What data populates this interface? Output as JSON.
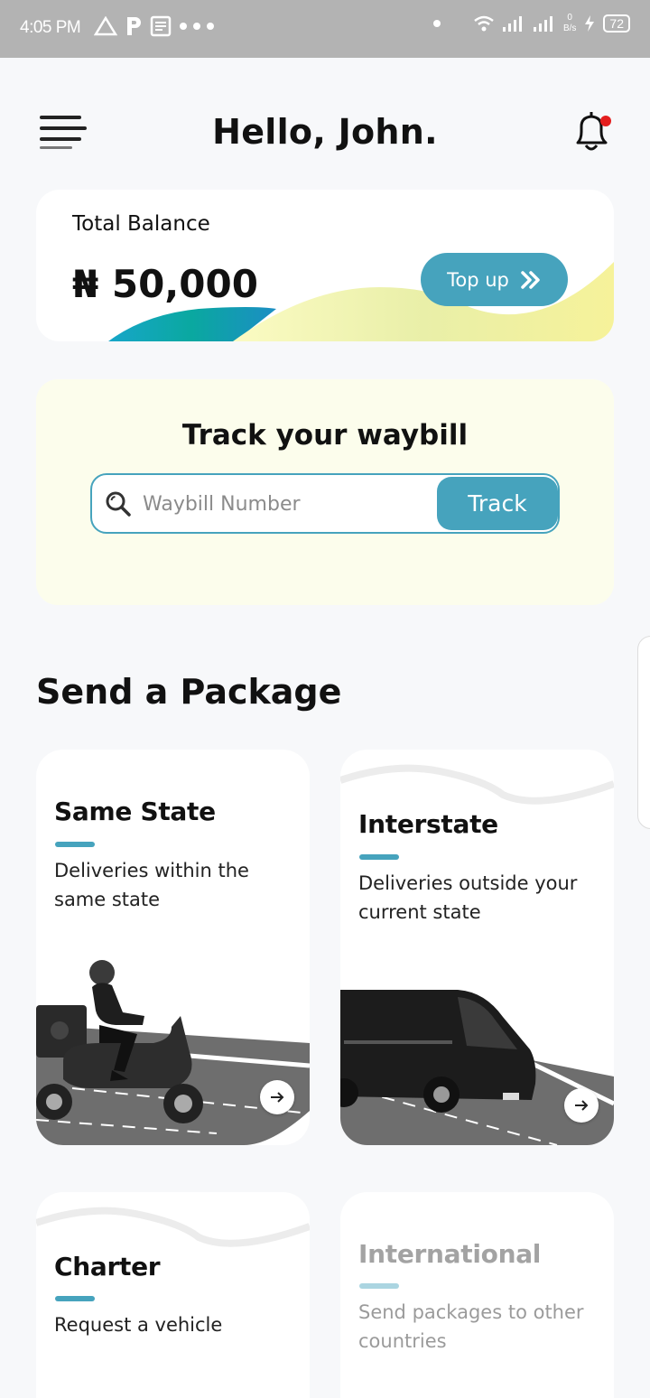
{
  "status_bar": {
    "time": "4:05 PM",
    "net_speed_value": "0",
    "net_speed_unit": "B/s",
    "battery": "72"
  },
  "header": {
    "greeting": "Hello, John."
  },
  "balance": {
    "label": "Total Balance",
    "amount": "₦ 50,000",
    "topup_label": "Top up"
  },
  "track": {
    "title": "Track your waybill",
    "placeholder": "Waybill Number",
    "button_label": "Track"
  },
  "send_package": {
    "title": "Send a Package",
    "cards": [
      {
        "title": "Same State",
        "description": "Deliveries within the same state",
        "icon": "scooter-rider-illustration"
      },
      {
        "title": "Interstate",
        "description": "Deliveries outside your current state",
        "icon": "van-illustration"
      },
      {
        "title": "Charter",
        "description": "Request a vehicle"
      },
      {
        "title": "International",
        "description": "Send packages to other countries",
        "disabled": true
      }
    ]
  },
  "colors": {
    "accent": "#46a3bd",
    "track_card_bg": "#fcfdec",
    "notification_dot": "#e41e1e"
  }
}
